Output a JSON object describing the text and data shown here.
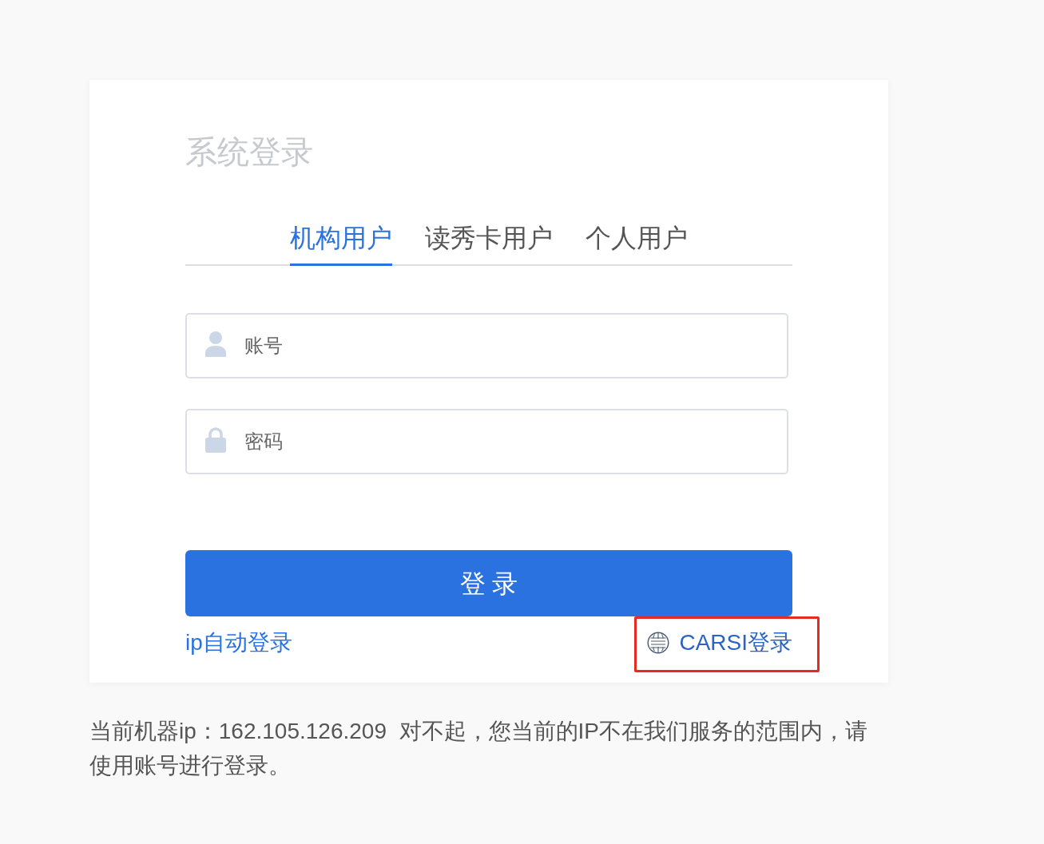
{
  "title": "系统登录",
  "tabs": [
    {
      "label": "机构用户",
      "selected": true
    },
    {
      "label": "读秀卡用户",
      "selected": false
    },
    {
      "label": "个人用户",
      "selected": false
    }
  ],
  "fields": [
    {
      "kind": "account",
      "placeholder": "账号"
    },
    {
      "kind": "password",
      "placeholder": "密码"
    }
  ],
  "login_button": "登 录",
  "links": [
    {
      "kind": "ip",
      "label": "ip自动登录",
      "highlighted": false
    },
    {
      "kind": "carsi",
      "label": "CARSI登录",
      "highlighted": true
    }
  ],
  "notice": "当前机器ip：162.105.126.209  对不起，您当前的IP不在我们服务的范围内，请使用账号进行登录。"
}
